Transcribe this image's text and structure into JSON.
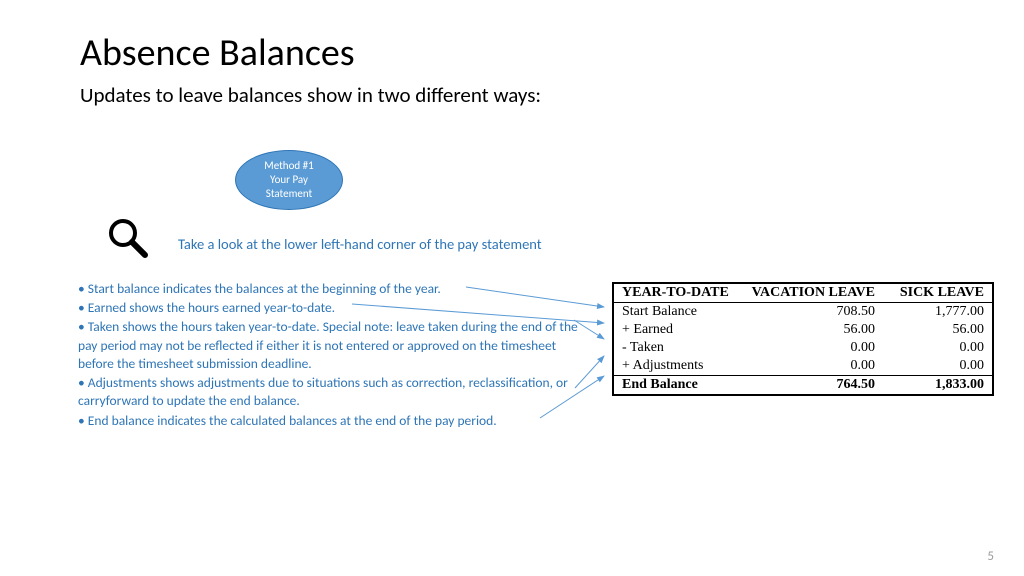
{
  "title": "Absence Balances",
  "subtitle": "Updates to leave balances show in two different ways:",
  "method_oval": {
    "line1": "Method #1",
    "line2": "Your Pay",
    "line3": "Statement"
  },
  "instruction": "Take a look at the lower left-hand corner of the pay statement",
  "bullets": [
    "• Start balance indicates the balances at the beginning of the year.",
    "• Earned shows the hours earned year-to-date.",
    "• Taken shows the hours taken year-to-date. Special note: leave taken during the end of the pay period may not be reflected if either it is not entered or approved on the timesheet before the timesheet submission deadline.",
    "• Adjustments shows adjustments due to situations such as correction, reclassification, or carryforward to update the end balance.",
    "• End balance indicates the calculated balances at the end of the pay period."
  ],
  "table": {
    "headers": [
      "YEAR-TO-DATE",
      "VACATION LEAVE",
      "SICK LEAVE"
    ],
    "rows": [
      {
        "label": "Start Balance",
        "vac": "708.50",
        "sick": "1,777.00"
      },
      {
        "label": "+ Earned",
        "vac": "56.00",
        "sick": "56.00"
      },
      {
        "label": "- Taken",
        "vac": "0.00",
        "sick": "0.00"
      },
      {
        "label": "+ Adjustments",
        "vac": "0.00",
        "sick": "0.00"
      }
    ],
    "footer": {
      "label": "End Balance",
      "vac": "764.50",
      "sick": "1,833.00"
    }
  },
  "page_number": "5"
}
